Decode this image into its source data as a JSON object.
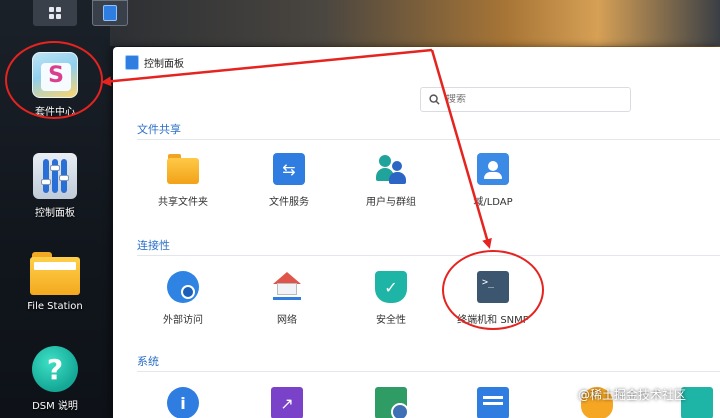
{
  "desktop": {
    "icons": [
      {
        "label": "套件中心",
        "icon": "package-center-icon"
      },
      {
        "label": "控制面板",
        "icon": "control-panel-icon"
      },
      {
        "label": "File Station",
        "icon": "folder-icon"
      },
      {
        "label": "DSM 说明",
        "icon": "help-icon"
      }
    ]
  },
  "window": {
    "title": "控制面板",
    "search": {
      "placeholder": "搜索"
    },
    "sections": [
      {
        "title": "文件共享",
        "items": [
          {
            "label": "共享文件夹",
            "icon": "shared-folder-icon"
          },
          {
            "label": "文件服务",
            "icon": "file-services-icon"
          },
          {
            "label": "用户与群组",
            "icon": "user-group-icon"
          },
          {
            "label": "域/LDAP",
            "icon": "domain-ldap-icon"
          }
        ]
      },
      {
        "title": "连接性",
        "items": [
          {
            "label": "外部访问",
            "icon": "external-access-icon"
          },
          {
            "label": "网络",
            "icon": "network-icon"
          },
          {
            "label": "安全性",
            "icon": "security-icon"
          },
          {
            "label": "终端机和 SNMP",
            "icon": "terminal-icon"
          }
        ]
      },
      {
        "title": "系统",
        "items": [
          {
            "label": "",
            "icon": "info-center-icon"
          },
          {
            "label": "",
            "icon": "update-restore-icon"
          },
          {
            "label": "",
            "icon": "task-scheduler-icon"
          },
          {
            "label": "",
            "icon": "notification-icon"
          },
          {
            "label": "",
            "icon": "hardware-power-icon"
          },
          {
            "label": "",
            "icon": "system-item-icon"
          }
        ]
      }
    ]
  },
  "watermark": "@稀土掘金技术社区",
  "colors": {
    "annotation": "#e5231f",
    "section_title": "#2b6fc7"
  }
}
